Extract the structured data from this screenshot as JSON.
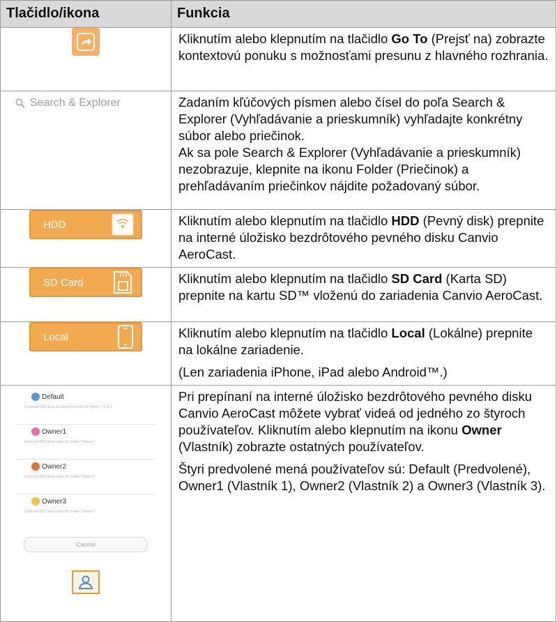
{
  "table": {
    "header_col1": "Tlačidlo/ikona",
    "header_col2": "Funkcia"
  },
  "rows": {
    "goto": {
      "icon": "share-arrow-icon",
      "t1": "Kliknutím alebo klepnutím na tlačidlo ",
      "bold": "Go To",
      "t2": " (Prejsť na) zobrazte kontextovú ponuku s možnosťami presunu z hlavného rozhrania."
    },
    "search": {
      "icon": "search-icon",
      "field_label": "Search & Explorer",
      "p1": "Zadaním kľúčových písmen alebo čísel do poľa Search & Explorer (Vyhľadávanie a prieskumník) vyhľadajte konkrétny súbor alebo priečinok.",
      "p1b": "Ak sa pole Search & Explorer (Vyhľadávanie a prieskumník) nezobrazuje, klepnite na ikonu Folder (Priečinok) a prehľadávaním priečinkov nájdite požadovaný súbor."
    },
    "hdd": {
      "button_label": "HDD",
      "icon": "wifi-drive-icon",
      "t1": "Kliknutím alebo klepnutím na tlačidlo ",
      "bold": "HDD",
      "t2": " (Pevný disk) prepnite na interné úložisko bezdrôtového pevného disku Canvio AeroCast."
    },
    "sd": {
      "button_label": "SD Card",
      "icon": "sd-card-icon",
      "t1": "Kliknutím alebo klepnutím na tlačidlo ",
      "bold": "SD Card",
      "t2": " (Karta SD) prepnite na kartu SD™ vloženú do zariadenia Canvio AeroCast."
    },
    "local": {
      "button_label": "Local",
      "icon": "phone-icon",
      "t1": "Kliknutím alebo klepnutím na tlačidlo ",
      "bold": "Local",
      "t2": " (Lokálne) prepnite na lokálne zariadenie.",
      "p2": "(Len zariadenia iPhone, iPad alebo Android™.)"
    },
    "owner": {
      "picker": {
        "options": [
          {
            "name": "Default",
            "sub": "Covered HDD area. All avoid for areas for Owner 1,2 & 3",
            "color": "#5b9bd5"
          },
          {
            "name": "Owner1",
            "sub": "Covered HDD area under the folder \"Owner1\"",
            "color": "#e86aa6"
          },
          {
            "name": "Owner2",
            "sub": "Covered HDD area under the folder \"Owner2\"",
            "color": "#e2733a"
          },
          {
            "name": "Owner3",
            "sub": "Covered HDD area under the folder \"Owner3\"",
            "color": "#f2c14e"
          }
        ],
        "cancel_label": "Cancel"
      },
      "button_icon": "user-icon",
      "p1a": "Pri prepínaní na interné úložisko bezdrôtového pevného disku Canvio AeroCast môžete vybrať videá od jedného zo štyroch používateľov. Kliknutím alebo klepnutím na ikonu ",
      "bold": "Owner",
      "p1b": " (Vlastník) zobrazte ostatných používateľov.",
      "p2": "Štyri predvolené mená používateľov sú: Default (Predvolené), Owner1 (Vlastník 1), Owner2 (Vlastník 2) a Owner3 (Vlastník 3)."
    }
  },
  "colors": {
    "accent_orange": "#f3a94f",
    "header_gray": "#d9d9d9"
  }
}
